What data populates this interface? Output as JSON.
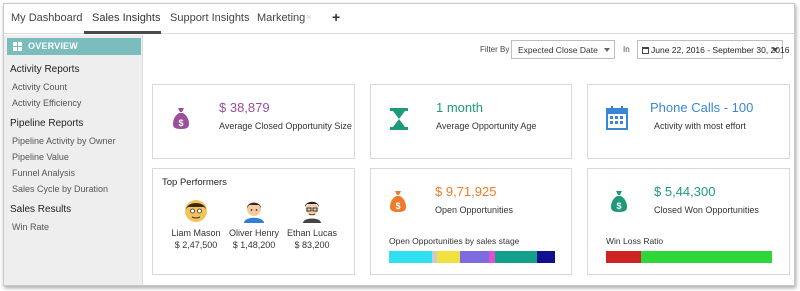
{
  "tabs": [
    {
      "label": "My Dashboard"
    },
    {
      "label": "Sales Insights"
    },
    {
      "label": "Support Insights"
    },
    {
      "label": "Marketing"
    }
  ],
  "tab_close_glyph": "×",
  "tab_add_glyph": "+",
  "sidebar": {
    "overview_label": "OVERVIEW",
    "sections": [
      {
        "title": "Activity Reports",
        "items": [
          "Activity Count",
          "Activity Efficiency"
        ]
      },
      {
        "title": "Pipeline Reports",
        "items": [
          "Pipeline Activity by Owner",
          "Pipeline Value",
          "Funnel Analysis",
          "Sales Cycle by Duration"
        ]
      },
      {
        "title": "Sales Results",
        "items": [
          "Win Rate"
        ]
      }
    ]
  },
  "filter": {
    "label": "Filter By",
    "selected": "Expected Close Date",
    "in_label": "In",
    "date_range": "June 22, 2016 - September 30, 2016"
  },
  "metrics": {
    "avg_closed": {
      "value": "$ 38,879",
      "label": "Average Closed Opportunity Size",
      "color": "#9b4f9b",
      "icon": "money-bag-icon"
    },
    "avg_age": {
      "value": "1 month",
      "label": "Average Opportunity Age",
      "color": "#1e9a7a",
      "icon": "hourglass-icon"
    },
    "activity": {
      "value": "Phone Calls - 100",
      "label": "Activity with most effort",
      "color": "#3a86d6",
      "icon": "calendar-icon"
    },
    "open_opps": {
      "value": "$ 9,71,925",
      "label": "Open Opportunities",
      "color": "#ee7b2a",
      "icon": "money-bag-icon"
    },
    "closed_won": {
      "value": "$ 5,44,300",
      "label": "Closed Won Opportunities",
      "color": "#1e9a7a",
      "icon": "money-bag-icon"
    }
  },
  "top_performers": {
    "title": "Top Performers",
    "people": [
      {
        "name": "Liam Mason",
        "amount": "$ 2,47,500"
      },
      {
        "name": "Oliver Henry",
        "amount": "$ 1,48,200"
      },
      {
        "name": "Ethan Lucas",
        "amount": "$ 83,200"
      }
    ]
  },
  "stage_bar": {
    "label": "Open Opportunities by sales stage",
    "segments": [
      {
        "color": "#2ee0f0",
        "share": 0.26
      },
      {
        "color": "#cccccc",
        "share": 0.03
      },
      {
        "color": "#f0e040",
        "share": 0.14
      },
      {
        "color": "#7f6be0",
        "share": 0.17
      },
      {
        "color": "#e050d0",
        "share": 0.04
      },
      {
        "color": "#13a08a",
        "share": 0.25
      },
      {
        "color": "#101090",
        "share": 0.11
      }
    ]
  },
  "win_loss": {
    "label": "Win Loss Ratio",
    "segments": [
      {
        "color": "#d02424",
        "share": 0.21
      },
      {
        "color": "#2ed63a",
        "share": 0.79
      }
    ]
  }
}
